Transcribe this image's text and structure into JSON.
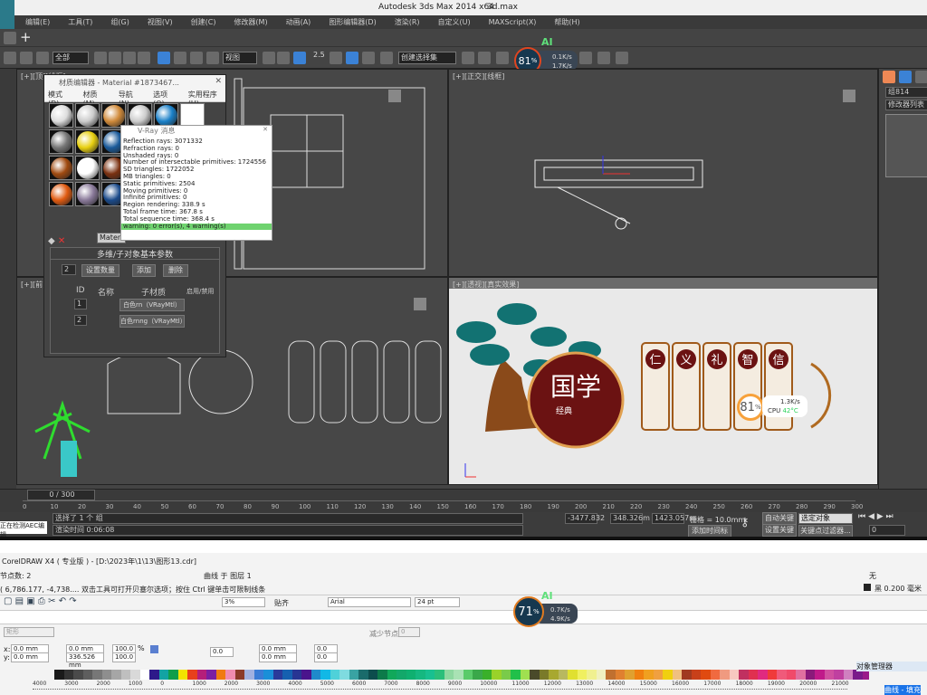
{
  "max": {
    "title": "Autodesk 3ds Max  2014 x64",
    "file": "3d.max",
    "menu": [
      "编辑(E)",
      "工具(T)",
      "组(G)",
      "视图(V)",
      "创建(C)",
      "修改器(M)",
      "动画(A)",
      "图形编辑器(D)",
      "渲染(R)",
      "自定义(U)",
      "MAXScript(X)",
      "帮助(H)"
    ],
    "toolbar": {
      "filter": "全部",
      "ref_coord": "视图",
      "selection_set": "创建选择集",
      "snap_value": "2.5"
    },
    "perf_widget": {
      "label": "AI",
      "cpu_percent": 81,
      "up": "0.1K/s",
      "down": "1.7K/s"
    },
    "viewports": {
      "top_left": "[+][顶][线框]",
      "top_right": "[+][正交][线框]",
      "bottom_left": "[+][前][线框]",
      "bottom_right": "[+][透视][真实效果]"
    },
    "command_panel": {
      "object_name": "组814",
      "modifier_list": "修改器列表"
    },
    "timeline": {
      "frame": "0 / 300",
      "ticks": [
        "0",
        "10",
        "20",
        "30",
        "40",
        "50",
        "60",
        "70",
        "80",
        "90",
        "100",
        "110",
        "120",
        "130",
        "140",
        "150",
        "160",
        "170",
        "180",
        "190",
        "200",
        "210",
        "220",
        "230",
        "240",
        "250",
        "260",
        "270",
        "280",
        "290",
        "300"
      ]
    },
    "status": {
      "left_label": "正在检测AEC编辑",
      "selected": "选择了 1 个 组",
      "render_time": "渲染时间 0:06:08",
      "x": "-3477.832",
      "y": "348.326m",
      "z": "1423.057m",
      "grid": "栅格 = 10.0mm",
      "auto_key": "自动关键点",
      "set_key": "设置关键点",
      "key_mode": "选定对象",
      "key_filter": "关键点过滤器...",
      "add_time_tag": "添加时间标记",
      "frame_input": "0"
    },
    "viewport_widget": {
      "cpu_percent": 81,
      "speed": "1.3K/s",
      "cpu_label": "CPU",
      "cpu_temp": "42°C"
    },
    "artwork": {
      "main": "国学",
      "badge": "经典",
      "virtues": [
        "仁",
        "义",
        "礼",
        "智",
        "信"
      ]
    }
  },
  "material_editor": {
    "title": "材质编辑器 - Material #1873467...",
    "menu": [
      "模式(D)",
      "材质(M)",
      "导航(N)",
      "选项(O)",
      "实用程序(U)"
    ],
    "material_name": "Material",
    "rollout_title": "多维/子对象基本参数",
    "count": "2",
    "set_count": "设置数量",
    "add": "添加",
    "delete": "删除",
    "col_id": "ID",
    "col_name": "名称",
    "col_sub": "子材质",
    "col_toggle": "启用/禁用",
    "rows": [
      {
        "id": "1",
        "sub": "白色rn（VRayMtl）"
      },
      {
        "id": "2",
        "sub": "白色rnng（VRayMtl）"
      }
    ]
  },
  "vray": {
    "title": "V-Ray 消息",
    "lines": [
      "Reflection rays: 3071332",
      "Refraction rays: 0",
      "Unshaded rays: 0",
      "Number of intersectable primitives: 1724556",
      " SD triangles: 1722052",
      " MB triangles: 0",
      " Static primitives: 2504",
      " Moving primitives: 0",
      " Infinite primitives: 0",
      "Region rendering: 338.9 s",
      "Total frame time: 367.8 s",
      "Total sequence time: 368.4 s"
    ],
    "warning": "warning: 0 error(s), 4 warning(s)"
  },
  "corel": {
    "title": "CorelDRAW X4 ( 专业版 ) - [D:\\2023年\\1\\13\\图形13.cdr]",
    "nodes": "节点数: 2",
    "layer": "曲线 于 图层 1",
    "hint": "( 6,786.177, -4,738....  双击工具可打开贝塞尔选项；按住 Ctrl 键单击可限制线条",
    "fill": "无",
    "outline": "黑  0.200 毫米",
    "zoom": "3%",
    "snap": "贴齐",
    "font": "Arial",
    "font_size": "24 pt",
    "shape": "矩形",
    "reduce_nodes": "减少节点",
    "reduce_value": "0",
    "x": "0.0 mm",
    "y": "0.0 mm",
    "w": "0.0 mm",
    "h": "336.526 mm",
    "sx": "100.0",
    "sy": "100.0",
    "pct": "%",
    "rot": "0.0",
    "px": "0.0 mm",
    "py": "0.0 mm",
    "a1": "0.0",
    "a2": "0.0",
    "perf_widget": {
      "label": "AI",
      "cpu_percent": 71,
      "up": "0.7K/s",
      "down": "4.9K/s"
    },
    "obj_manager": "对象管理器",
    "layer_item": "曲线 - 填充",
    "ruler": [
      "4000",
      "3000",
      "2000",
      "1000",
      "0",
      "1000",
      "2000",
      "3000",
      "4000",
      "5000",
      "6000",
      "7000",
      "8000",
      "9000",
      "10000",
      "11000",
      "12000",
      "13000",
      "14000",
      "15000",
      "16000",
      "17000",
      "18000",
      "19000",
      "20000",
      "21000"
    ],
    "palette": [
      "#1a1a1a",
      "#333",
      "#4a4a4a",
      "#5e5e5e",
      "#777",
      "#8e8e8e",
      "#a6a6a6",
      "#bfbfbf",
      "#d9d9d9",
      "#fff",
      "#2e1a8a",
      "#13a3a3",
      "#0e9e4a",
      "#f2e400",
      "#e8401c",
      "#b51e7a",
      "#7b1fa2",
      "#f07a10",
      "#f08cb0",
      "#8b3a2a",
      "#a0b0e0",
      "#3a7bd5",
      "#1a8fd8",
      "#2a3a9a",
      "#1560b0",
      "#283593",
      "#4a148c",
      "#1f8acb",
      "#11b8e6",
      "#4fd1d9",
      "#7fdbe0",
      "#39a3a3",
      "#1a6b6b",
      "#0d4d4d",
      "#0d7a4a",
      "#11a85a",
      "#13a86a",
      "#0fb070",
      "#15b880",
      "#18c090",
      "#2bbf7a",
      "#8ed8a0",
      "#a9e2b4",
      "#5acb6a",
      "#3aa84a",
      "#3ab02a",
      "#9ad22a",
      "#7acb4a",
      "#21c04a",
      "#a0e050",
      "#4a4a2a",
      "#7a7a2a",
      "#a8a830",
      "#b8b860",
      "#e0e030",
      "#f0f060",
      "#f0f090",
      "#f0f0c0",
      "#c07030",
      "#e08030",
      "#e0a030",
      "#f08010",
      "#f0a020",
      "#f0a040",
      "#f0d010",
      "#f0c080",
      "#a03a20",
      "#c8401a",
      "#e04a10",
      "#f06a40",
      "#f09a80",
      "#f8c8c0",
      "#c03060",
      "#e03050",
      "#e02a80",
      "#f03a3a",
      "#f05a7a",
      "#f04a6a",
      "#e070a0",
      "#8a1a7a",
      "#c01a8a",
      "#d050a0",
      "#c040a0",
      "#d080c0",
      "#7a1a8a",
      "#9a1a8a",
      "#8a2a9a",
      "#6a3aaa"
    ]
  }
}
